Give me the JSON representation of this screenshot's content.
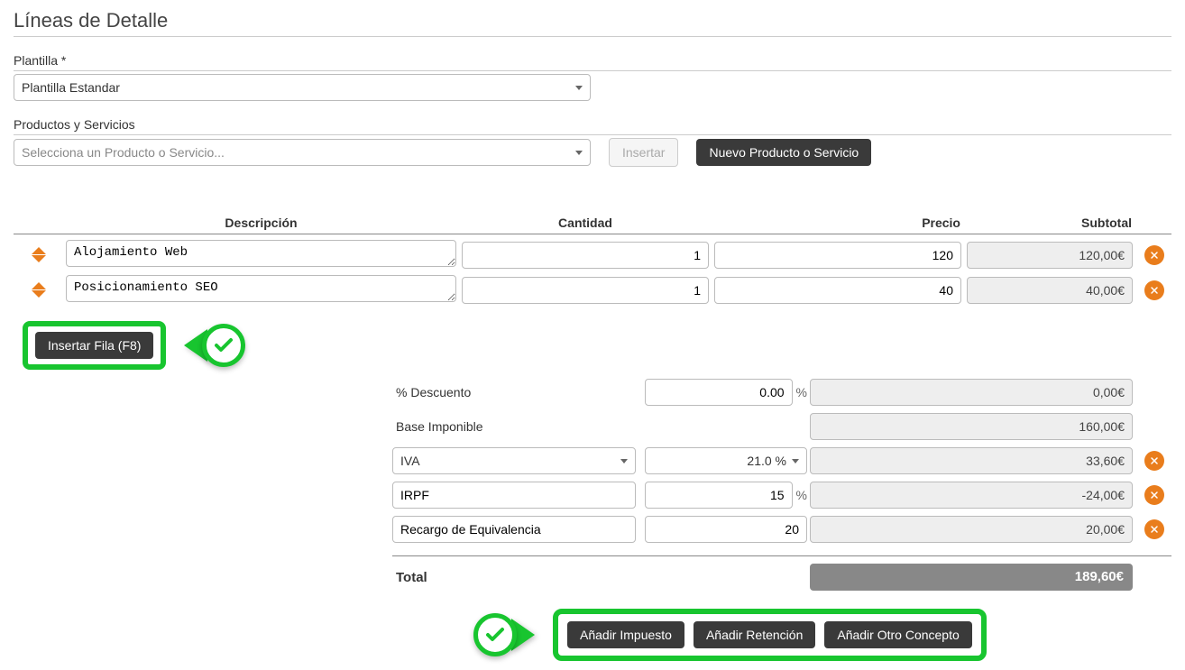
{
  "page": {
    "title": "Líneas de Detalle"
  },
  "plantilla": {
    "label": "Plantilla *",
    "selected": "Plantilla Estandar"
  },
  "productos": {
    "label": "Productos y Servicios",
    "placeholder": "Selecciona un Producto o Servicio...",
    "insertar_btn": "Insertar",
    "nuevo_btn": "Nuevo Producto o Servicio"
  },
  "grid": {
    "headers": {
      "descripcion": "Descripción",
      "cantidad": "Cantidad",
      "precio": "Precio",
      "subtotal": "Subtotal"
    },
    "rows": [
      {
        "descripcion": "Alojamiento Web",
        "cantidad": "1",
        "precio": "120",
        "subtotal": "120,00€"
      },
      {
        "descripcion": "Posicionamiento SEO",
        "cantidad": "1",
        "precio": "40",
        "subtotal": "40,00€"
      }
    ]
  },
  "insertar_fila_btn": "Insertar Fila (F8)",
  "totals": {
    "descuento": {
      "label": "% Descuento",
      "value": "0.00",
      "result": "0,00€"
    },
    "base": {
      "label": "Base Imponible",
      "result": "160,00€"
    },
    "iva": {
      "label": "IVA",
      "pct_selected": "21.0 %",
      "result": "33,60€"
    },
    "irpf": {
      "label": "IRPF",
      "value": "15",
      "result": "-24,00€"
    },
    "recargo": {
      "label": "Recargo de Equivalencia",
      "value": "20",
      "result": "20,00€"
    },
    "total": {
      "label": "Total",
      "result": "189,60€"
    }
  },
  "bottom_buttons": {
    "impuesto": "Añadir Impuesto",
    "retencion": "Añadir Retención",
    "otro": "Añadir Otro Concepto"
  }
}
